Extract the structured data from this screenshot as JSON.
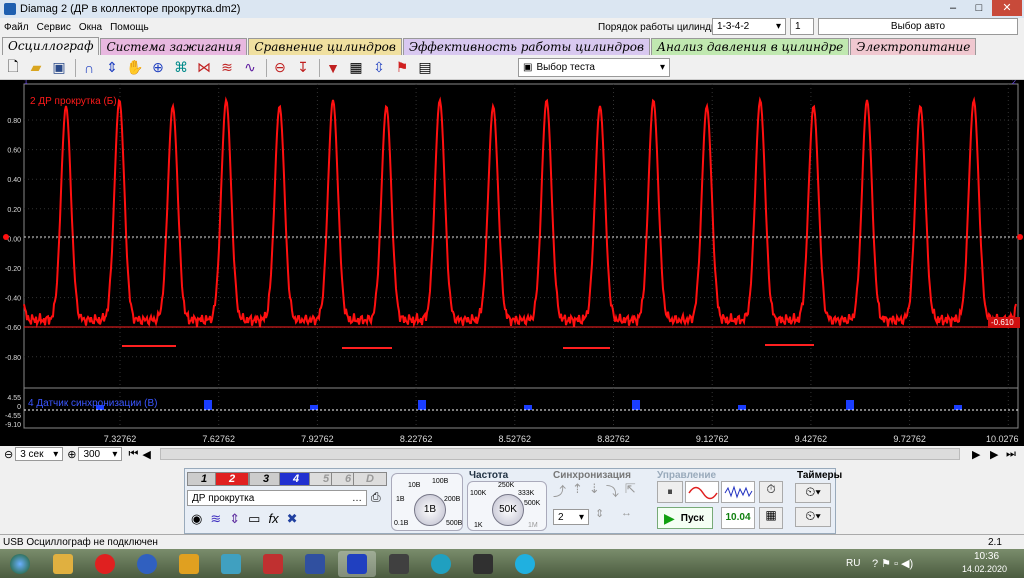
{
  "window": {
    "title": "Diamag 2 (ДР в коллекторе прокрутка.dm2)"
  },
  "menu": {
    "items": [
      "Файл",
      "Сервис",
      "Окна",
      "Помощь"
    ],
    "cyl_order_label": "Порядок работы цилиндров",
    "cyl_order_value": "1-3-4-2",
    "cyl_num": "1",
    "auto_select": "Выбор авто"
  },
  "tabs": [
    {
      "label": "Осциллограф",
      "color": "#f0f0f0"
    },
    {
      "label": "Система зажигания",
      "color": "#e8b8e0"
    },
    {
      "label": "Сравнение цилиндров",
      "color": "#f0e0a0"
    },
    {
      "label": "Эффективность работы цилиндров",
      "color": "#d8c8f0"
    },
    {
      "label": "Анализ давления в цилиндре",
      "color": "#c0e8b0"
    },
    {
      "label": "Электропитание",
      "color": "#f0c8d0"
    }
  ],
  "toolbar": {
    "test_select": "Выбор теста"
  },
  "scope": {
    "channel_top_label": "2 ДР прокрутка (Б)",
    "channel_bottom_label": "4 Датчик синхронизации (В)",
    "y_ticks": [
      "0.80",
      "0.60",
      "0.40",
      "0.20",
      "0.00",
      "-0.20",
      "-0.40",
      "-0.60",
      "-0.80"
    ],
    "y_ticks_bottom": [
      "4.55",
      "0",
      "-4.55",
      "-9.10"
    ],
    "x_ticks": [
      "7.32762",
      "7.62762",
      "7.92762",
      "8.22762",
      "8.52762",
      "8.82762",
      "9.12762",
      "9.42762",
      "9.72762",
      "10.0276"
    ],
    "cursor_value": "-0.610",
    "marker_1": "1",
    "marker_2": "2",
    "trace_color": "#ff1010",
    "sync_color": "#1a3dff"
  },
  "bottom": {
    "time_scale": "3 сек",
    "zoom": "300"
  },
  "panel": {
    "channels": [
      "1",
      "2",
      "3",
      "4",
      "5",
      "6",
      "D"
    ],
    "channel_name": "ДР прокрутка",
    "volt_knob": "1В",
    "volt_labels": [
      "10В",
      "100В",
      "1В",
      "200В",
      "0.1В",
      "500В"
    ],
    "freq_title": "Частота",
    "freq_knob": "50K",
    "freq_labels": [
      "250K",
      "100K",
      "333K",
      "500K",
      "1K",
      "1M"
    ],
    "sync_title": "Синхронизация",
    "sync_value": "2",
    "control_title": "Управление",
    "start_label": "Пуск",
    "version": "10.04",
    "timers_title": "Таймеры"
  },
  "status": {
    "text": "USB Осциллограф не подключен",
    "right": "2.1"
  },
  "taskbar": {
    "lang": "RU",
    "time": "10:36",
    "date": "14.02.2020"
  }
}
